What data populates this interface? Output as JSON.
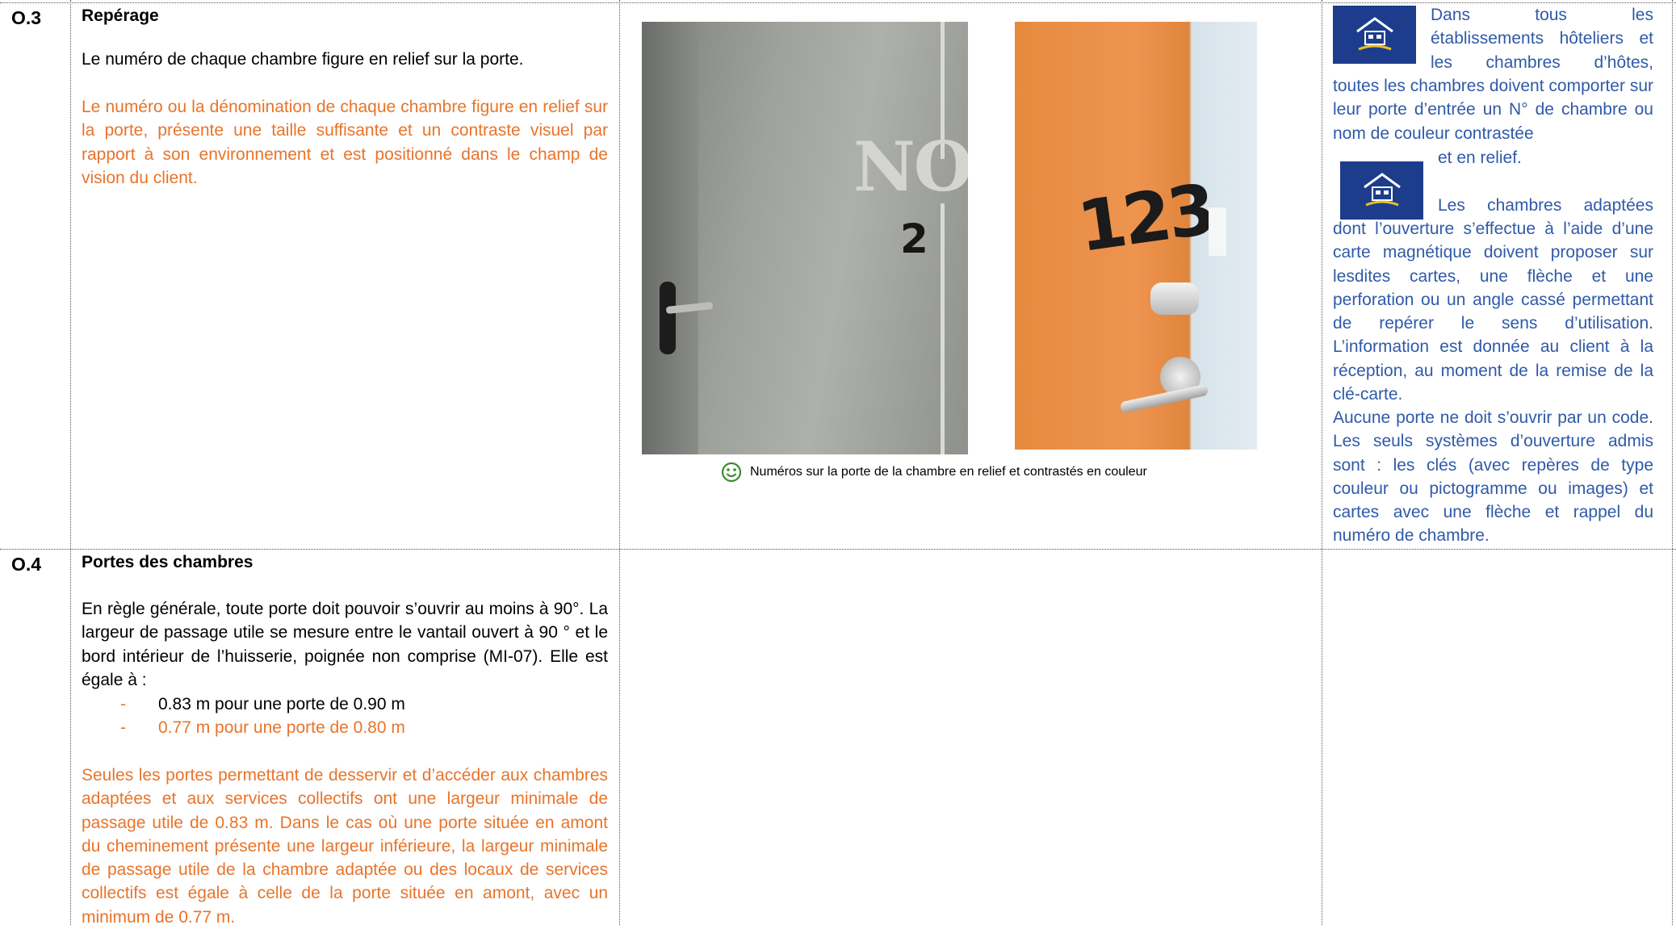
{
  "row1": {
    "code": "O.3",
    "title": "Repérage",
    "text_black": "Le numéro de chaque chambre figure en relief sur la porte.",
    "text_orange": "Le numéro ou la dénomination de chaque chambre figure en relief sur la porte, présente une taille suffisante et un contraste visuel par rapport à son environnement et est positionné dans le champ de vision du client.",
    "photo1_text_no": "NO",
    "photo1_text_num": "2",
    "photo2_text_num": "123",
    "caption": "Numéros sur la porte de la chambre en relief et contrastés en couleur",
    "side_line1": [
      "Dans",
      "tous",
      "les"
    ],
    "side_line2": [
      "établissements",
      "hôteliers",
      "et"
    ],
    "side_line3": [
      "les",
      "chambres",
      "d’hôtes,"
    ],
    "side_para1_rest": "toutes les chambres doivent comporter sur leur porte d’entrée un N° de chambre ou nom de couleur contrastée",
    "side_para1_end": "et en relief.",
    "side_para2_first": [
      "Les",
      "chambres",
      "adaptées"
    ],
    "side_para2_rest": "dont l’ouverture s’effectue à l’aide d’une carte magnétique doivent proposer sur lesdites cartes, une flèche et une perforation ou un angle cassé permettant de repérer le sens d’utilisation. L’information est donnée au client à la réception, au moment de la remise de la clé-carte.",
    "side_para3": "Aucune porte ne doit s’ouvrir par un code. Les seuls systèmes d’ouverture admis sont : les clés (avec repères de type couleur ou pictogramme ou images) et cartes avec une flèche et rappel du numéro de chambre."
  },
  "row2": {
    "code": "O.4",
    "title": "Portes des chambres",
    "text_black": "En règle générale, toute porte doit pouvoir s’ouvrir au moins à 90°. La largeur de passage utile se mesure entre le vantail ouvert à 90 ° et le bord intérieur de l’huisserie, poignée non comprise (MI-07). Elle est égale à :",
    "list": [
      {
        "dash": "-",
        "text": "0.83 m pour une porte de 0.90 m"
      },
      {
        "dash": "-",
        "text": "0.77 m pour une porte de 0.80 m"
      }
    ],
    "text_orange": "Seules les portes permettant de desservir et d’accéder aux chambres adaptées et aux services collectifs ont une largeur minimale de passage utile de 0.83 m.  Dans le cas où une porte située en amont du cheminement présente une largeur inférieure, la largeur minimale de passage utile de la chambre adaptée ou des locaux de services collectifs est égale à celle de la porte située en amont, avec un minimum de 0.77 m."
  },
  "colors": {
    "orange": "#e8742a",
    "blue": "#2f5aa8",
    "logo": "#1d3c8c"
  }
}
